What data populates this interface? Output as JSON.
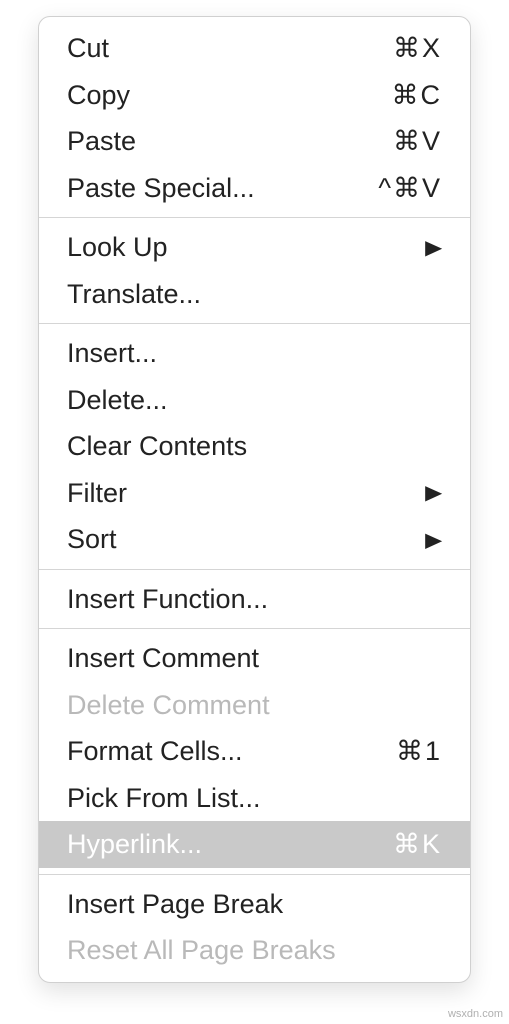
{
  "menu": {
    "groups": [
      [
        {
          "id": "cut",
          "label": "Cut",
          "shortcut": "⌘X",
          "disabled": false,
          "submenu": false,
          "selected": false
        },
        {
          "id": "copy",
          "label": "Copy",
          "shortcut": "⌘C",
          "disabled": false,
          "submenu": false,
          "selected": false
        },
        {
          "id": "paste",
          "label": "Paste",
          "shortcut": "⌘V",
          "disabled": false,
          "submenu": false,
          "selected": false
        },
        {
          "id": "paste-special",
          "label": "Paste Special...",
          "shortcut": "^⌘V",
          "disabled": false,
          "submenu": false,
          "selected": false
        }
      ],
      [
        {
          "id": "look-up",
          "label": "Look Up",
          "shortcut": "",
          "disabled": false,
          "submenu": true,
          "selected": false
        },
        {
          "id": "translate",
          "label": "Translate...",
          "shortcut": "",
          "disabled": false,
          "submenu": false,
          "selected": false
        }
      ],
      [
        {
          "id": "insert",
          "label": "Insert...",
          "shortcut": "",
          "disabled": false,
          "submenu": false,
          "selected": false
        },
        {
          "id": "delete",
          "label": "Delete...",
          "shortcut": "",
          "disabled": false,
          "submenu": false,
          "selected": false
        },
        {
          "id": "clear-contents",
          "label": "Clear Contents",
          "shortcut": "",
          "disabled": false,
          "submenu": false,
          "selected": false
        },
        {
          "id": "filter",
          "label": "Filter",
          "shortcut": "",
          "disabled": false,
          "submenu": true,
          "selected": false
        },
        {
          "id": "sort",
          "label": "Sort",
          "shortcut": "",
          "disabled": false,
          "submenu": true,
          "selected": false
        }
      ],
      [
        {
          "id": "insert-function",
          "label": "Insert Function...",
          "shortcut": "",
          "disabled": false,
          "submenu": false,
          "selected": false
        }
      ],
      [
        {
          "id": "insert-comment",
          "label": "Insert Comment",
          "shortcut": "",
          "disabled": false,
          "submenu": false,
          "selected": false
        },
        {
          "id": "delete-comment",
          "label": "Delete Comment",
          "shortcut": "",
          "disabled": true,
          "submenu": false,
          "selected": false
        },
        {
          "id": "format-cells",
          "label": "Format Cells...",
          "shortcut": "⌘1",
          "disabled": false,
          "submenu": false,
          "selected": false
        },
        {
          "id": "pick-from-list",
          "label": "Pick From List...",
          "shortcut": "",
          "disabled": false,
          "submenu": false,
          "selected": false
        },
        {
          "id": "hyperlink",
          "label": "Hyperlink...",
          "shortcut": "⌘K",
          "disabled": false,
          "submenu": false,
          "selected": true
        }
      ],
      [
        {
          "id": "insert-page-break",
          "label": "Insert Page Break",
          "shortcut": "",
          "disabled": false,
          "submenu": false,
          "selected": false
        },
        {
          "id": "reset-all-page-breaks",
          "label": "Reset All Page Breaks",
          "shortcut": "",
          "disabled": true,
          "submenu": false,
          "selected": false
        }
      ]
    ]
  },
  "watermark": "wsxdn.com"
}
